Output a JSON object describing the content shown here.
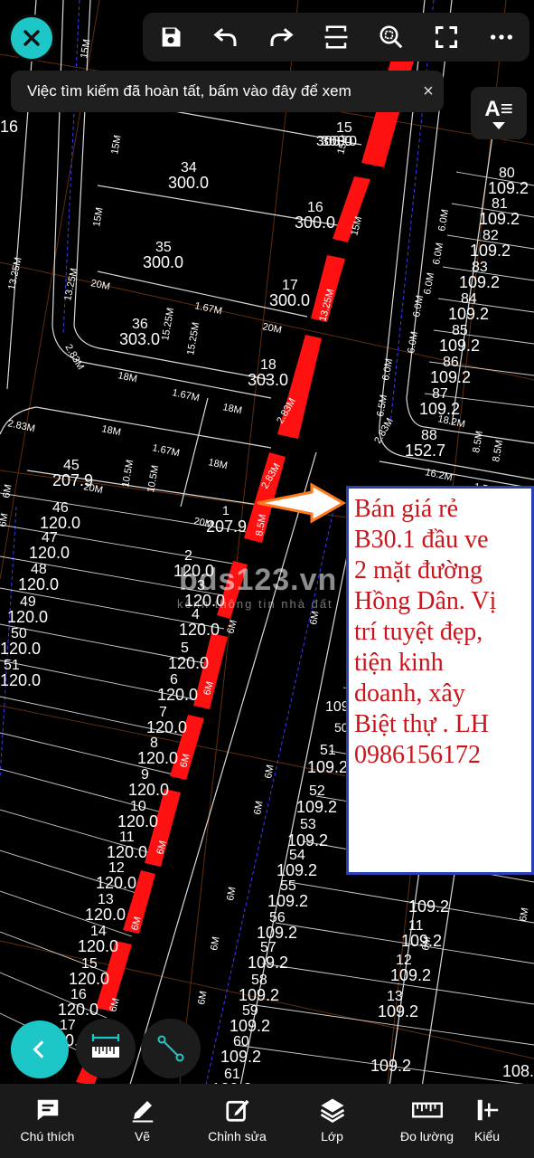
{
  "toolbar": {
    "close": "close-icon",
    "items": [
      "save-icon",
      "undo-icon",
      "redo-icon",
      "crop-icon",
      "zoom-fit-icon",
      "fullscreen-icon",
      "more-icon"
    ]
  },
  "banner": {
    "text": "Việc tìm kiếm đã hoàn tất, bấm vào đây để xem",
    "close": "×"
  },
  "text_style_button": {
    "label": "A≡"
  },
  "callout": {
    "lines": [
      "Bán giá rẻ",
      "B30.1 đầu ve",
      "2 mặt đường",
      "Hồng Dân. Vị",
      "trí tuyệt đẹp,",
      "tiện kinh",
      "doanh, xây",
      "Biệt thự . LH",
      "0986156172"
    ]
  },
  "watermark": {
    "text": "bds123.vn",
    "sub": "kênh thông tin nhà đất"
  },
  "bottom_bar": {
    "items": [
      {
        "label": "Chú thích",
        "icon": "comment-icon"
      },
      {
        "label": "Vẽ",
        "icon": "pencil-icon"
      },
      {
        "label": "Chỉnh sửa",
        "icon": "edit-icon"
      },
      {
        "label": "Lớp",
        "icon": "layers-icon"
      },
      {
        "label": "Đo lường",
        "icon": "ruler-icon"
      },
      {
        "label": "Kiểu",
        "icon": "style-icon"
      }
    ]
  },
  "map_labels": [
    {
      "t": "300.0"
    },
    {
      "t": "16"
    },
    {
      "t": "300.0"
    },
    {
      "t": "33"
    },
    {
      "t": "300.0"
    },
    {
      "t": "15"
    },
    {
      "t": "300.0"
    },
    {
      "t": "34"
    },
    {
      "t": "300.0"
    },
    {
      "t": "16"
    },
    {
      "t": "300.0"
    },
    {
      "t": "35"
    },
    {
      "t": "300.0"
    },
    {
      "t": "17"
    },
    {
      "t": "300.0"
    },
    {
      "t": "36"
    },
    {
      "t": "303.0"
    },
    {
      "t": "18"
    },
    {
      "t": "303.0"
    },
    {
      "t": "45"
    },
    {
      "t": "207.9"
    },
    {
      "t": "1"
    },
    {
      "t": "207.9"
    },
    {
      "t": "46"
    },
    {
      "t": "120.0"
    },
    {
      "t": "47"
    },
    {
      "t": "120.0"
    },
    {
      "t": "48"
    },
    {
      "t": "120.0"
    },
    {
      "t": "49"
    },
    {
      "t": "120.0"
    },
    {
      "t": "50"
    },
    {
      "t": "120.0"
    },
    {
      "t": "51"
    },
    {
      "t": "120.0"
    },
    {
      "t": "2"
    },
    {
      "t": "120.0"
    },
    {
      "t": "3"
    },
    {
      "t": "120.0"
    },
    {
      "t": "4"
    },
    {
      "t": "120.0"
    },
    {
      "t": "5"
    },
    {
      "t": "120.0"
    },
    {
      "t": "6"
    },
    {
      "t": "120.0"
    },
    {
      "t": "7"
    },
    {
      "t": "120.0"
    },
    {
      "t": "8"
    },
    {
      "t": "120.0"
    },
    {
      "t": "9"
    },
    {
      "t": "120.0"
    },
    {
      "t": "10"
    },
    {
      "t": "120.0"
    },
    {
      "t": "11"
    },
    {
      "t": "120.0"
    },
    {
      "t": "12"
    },
    {
      "t": "120.0"
    },
    {
      "t": "13"
    },
    {
      "t": "120.0"
    },
    {
      "t": "14"
    },
    {
      "t": "120.0"
    },
    {
      "t": "15"
    },
    {
      "t": "120.0"
    },
    {
      "t": "16"
    },
    {
      "t": "120.0"
    },
    {
      "t": "17"
    },
    {
      "t": "120.0"
    },
    {
      "t": "80"
    },
    {
      "t": "109.2"
    },
    {
      "t": "81"
    },
    {
      "t": "109.2"
    },
    {
      "t": "82"
    },
    {
      "t": "109.2"
    },
    {
      "t": "83"
    },
    {
      "t": "109.2"
    },
    {
      "t": "84"
    },
    {
      "t": "109.2"
    },
    {
      "t": "85"
    },
    {
      "t": "109.2"
    },
    {
      "t": "86"
    },
    {
      "t": "109.2"
    },
    {
      "t": "87"
    },
    {
      "t": "109.2"
    },
    {
      "t": "88"
    },
    {
      "t": "152.7"
    },
    {
      "t": "50"
    },
    {
      "t": "109"
    },
    {
      "t": "51"
    },
    {
      "t": "109.2"
    },
    {
      "t": "52"
    },
    {
      "t": "109.2"
    },
    {
      "t": "53"
    },
    {
      "t": "109.2"
    },
    {
      "t": "54"
    },
    {
      "t": "109.2"
    },
    {
      "t": "55"
    },
    {
      "t": "109.2"
    },
    {
      "t": "56"
    },
    {
      "t": "109.2"
    },
    {
      "t": "57"
    },
    {
      "t": "109.2"
    },
    {
      "t": "58"
    },
    {
      "t": "109.2"
    },
    {
      "t": "59"
    },
    {
      "t": "109.2"
    },
    {
      "t": "60"
    },
    {
      "t": "109.2"
    },
    {
      "t": "61"
    },
    {
      "t": "109.2"
    },
    {
      "t": "109.2"
    },
    {
      "t": "11"
    },
    {
      "t": "109.2"
    },
    {
      "t": "12"
    },
    {
      "t": "109.2"
    },
    {
      "t": "13"
    },
    {
      "t": "109.2"
    },
    {
      "t": "109.2"
    },
    {
      "t": "108.0"
    },
    {
      "t": "15M"
    },
    {
      "t": "15M"
    },
    {
      "t": "15M"
    },
    {
      "t": "15M"
    },
    {
      "t": "15M"
    },
    {
      "t": "13.25M"
    },
    {
      "t": "13.25M"
    },
    {
      "t": "20M"
    },
    {
      "t": "1.67M"
    },
    {
      "t": "20M"
    },
    {
      "t": "15.25M"
    },
    {
      "t": "15.25M"
    },
    {
      "t": "2.83M"
    },
    {
      "t": "18M"
    },
    {
      "t": "1.67M"
    },
    {
      "t": "18M"
    },
    {
      "t": "13.25M"
    },
    {
      "t": "2.83M"
    },
    {
      "t": "2.83M"
    },
    {
      "t": "18M"
    },
    {
      "t": "1.67M"
    },
    {
      "t": "18M"
    },
    {
      "t": "20M"
    },
    {
      "t": "10.5M"
    },
    {
      "t": "10.5M"
    },
    {
      "t": "20M"
    },
    {
      "t": "2.83M"
    },
    {
      "t": "8.5M"
    },
    {
      "t": "6M"
    },
    {
      "t": "6M"
    },
    {
      "t": "6M"
    },
    {
      "t": "6M"
    },
    {
      "t": "6M"
    },
    {
      "t": "6M"
    },
    {
      "t": "6M"
    },
    {
      "t": "6M"
    },
    {
      "t": "6.0M"
    },
    {
      "t": "6.0M"
    },
    {
      "t": "6.0M"
    },
    {
      "t": "6.0M"
    },
    {
      "t": "6.0M"
    },
    {
      "t": "6.0M"
    },
    {
      "t": "6.5M"
    },
    {
      "t": "18.2M"
    },
    {
      "t": "2.83M"
    },
    {
      "t": "8.5M"
    },
    {
      "t": "8.5M"
    },
    {
      "t": "16.2M"
    },
    {
      "t": "1.5M"
    },
    {
      "t": "6M"
    },
    {
      "t": "6M"
    },
    {
      "t": "6M"
    },
    {
      "t": "6M"
    },
    {
      "t": "6M"
    },
    {
      "t": "6M"
    },
    {
      "t": "6M"
    },
    {
      "t": "6M"
    },
    {
      "t": "6M"
    }
  ]
}
